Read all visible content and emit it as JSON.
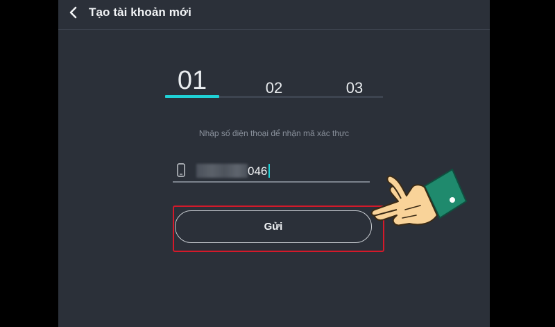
{
  "header": {
    "title": "Tạo tài khoản mới",
    "back_icon": "chevron-left-icon"
  },
  "steps": {
    "items": [
      "01",
      "02",
      "03"
    ],
    "active_index": 0,
    "active_color": "#1fd1d6"
  },
  "form": {
    "hint": "Nhập số điện thoại để nhận mã xác thực",
    "phone_icon": "phone-icon",
    "phone_value_visible": "046",
    "phone_prefix_obscured": true
  },
  "actions": {
    "send_label": "Gửi"
  },
  "annotation": {
    "highlight_color": "#d4192a",
    "pointer": "pointing-hand-icon"
  }
}
